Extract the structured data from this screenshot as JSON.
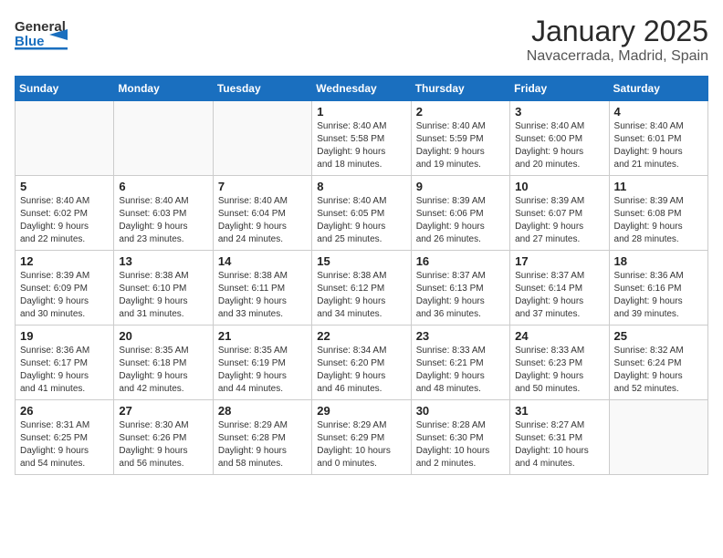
{
  "header": {
    "logo_general": "General",
    "logo_blue": "Blue",
    "month": "January 2025",
    "location": "Navacerrada, Madrid, Spain"
  },
  "weekdays": [
    "Sunday",
    "Monday",
    "Tuesday",
    "Wednesday",
    "Thursday",
    "Friday",
    "Saturday"
  ],
  "weeks": [
    [
      {
        "day": "",
        "info": ""
      },
      {
        "day": "",
        "info": ""
      },
      {
        "day": "",
        "info": ""
      },
      {
        "day": "1",
        "info": "Sunrise: 8:40 AM\nSunset: 5:58 PM\nDaylight: 9 hours\nand 18 minutes."
      },
      {
        "day": "2",
        "info": "Sunrise: 8:40 AM\nSunset: 5:59 PM\nDaylight: 9 hours\nand 19 minutes."
      },
      {
        "day": "3",
        "info": "Sunrise: 8:40 AM\nSunset: 6:00 PM\nDaylight: 9 hours\nand 20 minutes."
      },
      {
        "day": "4",
        "info": "Sunrise: 8:40 AM\nSunset: 6:01 PM\nDaylight: 9 hours\nand 21 minutes."
      }
    ],
    [
      {
        "day": "5",
        "info": "Sunrise: 8:40 AM\nSunset: 6:02 PM\nDaylight: 9 hours\nand 22 minutes."
      },
      {
        "day": "6",
        "info": "Sunrise: 8:40 AM\nSunset: 6:03 PM\nDaylight: 9 hours\nand 23 minutes."
      },
      {
        "day": "7",
        "info": "Sunrise: 8:40 AM\nSunset: 6:04 PM\nDaylight: 9 hours\nand 24 minutes."
      },
      {
        "day": "8",
        "info": "Sunrise: 8:40 AM\nSunset: 6:05 PM\nDaylight: 9 hours\nand 25 minutes."
      },
      {
        "day": "9",
        "info": "Sunrise: 8:39 AM\nSunset: 6:06 PM\nDaylight: 9 hours\nand 26 minutes."
      },
      {
        "day": "10",
        "info": "Sunrise: 8:39 AM\nSunset: 6:07 PM\nDaylight: 9 hours\nand 27 minutes."
      },
      {
        "day": "11",
        "info": "Sunrise: 8:39 AM\nSunset: 6:08 PM\nDaylight: 9 hours\nand 28 minutes."
      }
    ],
    [
      {
        "day": "12",
        "info": "Sunrise: 8:39 AM\nSunset: 6:09 PM\nDaylight: 9 hours\nand 30 minutes."
      },
      {
        "day": "13",
        "info": "Sunrise: 8:38 AM\nSunset: 6:10 PM\nDaylight: 9 hours\nand 31 minutes."
      },
      {
        "day": "14",
        "info": "Sunrise: 8:38 AM\nSunset: 6:11 PM\nDaylight: 9 hours\nand 33 minutes."
      },
      {
        "day": "15",
        "info": "Sunrise: 8:38 AM\nSunset: 6:12 PM\nDaylight: 9 hours\nand 34 minutes."
      },
      {
        "day": "16",
        "info": "Sunrise: 8:37 AM\nSunset: 6:13 PM\nDaylight: 9 hours\nand 36 minutes."
      },
      {
        "day": "17",
        "info": "Sunrise: 8:37 AM\nSunset: 6:14 PM\nDaylight: 9 hours\nand 37 minutes."
      },
      {
        "day": "18",
        "info": "Sunrise: 8:36 AM\nSunset: 6:16 PM\nDaylight: 9 hours\nand 39 minutes."
      }
    ],
    [
      {
        "day": "19",
        "info": "Sunrise: 8:36 AM\nSunset: 6:17 PM\nDaylight: 9 hours\nand 41 minutes."
      },
      {
        "day": "20",
        "info": "Sunrise: 8:35 AM\nSunset: 6:18 PM\nDaylight: 9 hours\nand 42 minutes."
      },
      {
        "day": "21",
        "info": "Sunrise: 8:35 AM\nSunset: 6:19 PM\nDaylight: 9 hours\nand 44 minutes."
      },
      {
        "day": "22",
        "info": "Sunrise: 8:34 AM\nSunset: 6:20 PM\nDaylight: 9 hours\nand 46 minutes."
      },
      {
        "day": "23",
        "info": "Sunrise: 8:33 AM\nSunset: 6:21 PM\nDaylight: 9 hours\nand 48 minutes."
      },
      {
        "day": "24",
        "info": "Sunrise: 8:33 AM\nSunset: 6:23 PM\nDaylight: 9 hours\nand 50 minutes."
      },
      {
        "day": "25",
        "info": "Sunrise: 8:32 AM\nSunset: 6:24 PM\nDaylight: 9 hours\nand 52 minutes."
      }
    ],
    [
      {
        "day": "26",
        "info": "Sunrise: 8:31 AM\nSunset: 6:25 PM\nDaylight: 9 hours\nand 54 minutes."
      },
      {
        "day": "27",
        "info": "Sunrise: 8:30 AM\nSunset: 6:26 PM\nDaylight: 9 hours\nand 56 minutes."
      },
      {
        "day": "28",
        "info": "Sunrise: 8:29 AM\nSunset: 6:28 PM\nDaylight: 9 hours\nand 58 minutes."
      },
      {
        "day": "29",
        "info": "Sunrise: 8:29 AM\nSunset: 6:29 PM\nDaylight: 10 hours\nand 0 minutes."
      },
      {
        "day": "30",
        "info": "Sunrise: 8:28 AM\nSunset: 6:30 PM\nDaylight: 10 hours\nand 2 minutes."
      },
      {
        "day": "31",
        "info": "Sunrise: 8:27 AM\nSunset: 6:31 PM\nDaylight: 10 hours\nand 4 minutes."
      },
      {
        "day": "",
        "info": ""
      }
    ]
  ]
}
